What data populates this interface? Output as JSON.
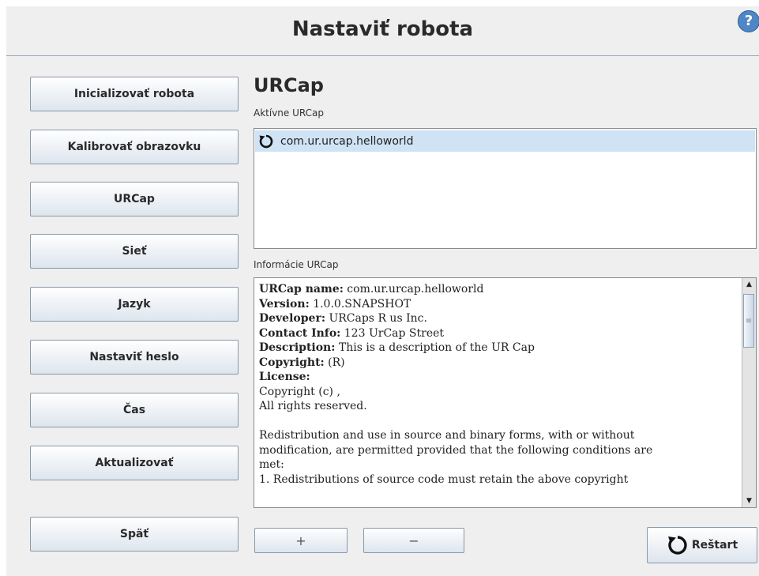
{
  "header": {
    "title": "Nastaviť robota",
    "help_icon": "?"
  },
  "sidebar": {
    "items": [
      {
        "label": "Inicializovať robota"
      },
      {
        "label": "Kalibrovať obrazovku"
      },
      {
        "label": "URCap"
      },
      {
        "label": "Sieť"
      },
      {
        "label": "Jazyk"
      },
      {
        "label": "Nastaviť heslo"
      },
      {
        "label": "Čas"
      },
      {
        "label": "Aktualizovať"
      }
    ],
    "back_label": "Späť"
  },
  "main": {
    "title": "URCap",
    "active_label": "Aktívne URCap",
    "active_items": [
      {
        "name": "com.ur.urcap.helloworld",
        "icon": "refresh-icon"
      }
    ],
    "info_label": "Informácie URCap",
    "info": {
      "name_key": "URCap name:",
      "name_val": " com.ur.urcap.helloworld",
      "version_key": "Version:",
      "version_val": " 1.0.0.SNAPSHOT",
      "developer_key": "Developer:",
      "developer_val": " URCaps R us Inc.",
      "contact_key": "Contact Info:",
      "contact_val": " 123 UrCap Street",
      "description_key": "Description:",
      "description_val": " This is a description of the UR Cap",
      "copyright_key": "Copyright:",
      "copyright_val": " (R)",
      "license_key": "License:",
      "license_lines": [
        "Copyright (c) ,",
        "All rights reserved.",
        "",
        "Redistribution and use in source and binary forms, with or without",
        "modification, are permitted provided that the following conditions are",
        "met:",
        "1. Redistributions of source code must retain the above copyright"
      ]
    },
    "add_symbol": "+",
    "remove_symbol": "−",
    "restart_label": "Reštart"
  },
  "colors": {
    "selection": "#cfe3f5",
    "button_top": "#ffffff",
    "button_bottom": "#dde5ee",
    "icon_blue": "#4f86c6"
  }
}
